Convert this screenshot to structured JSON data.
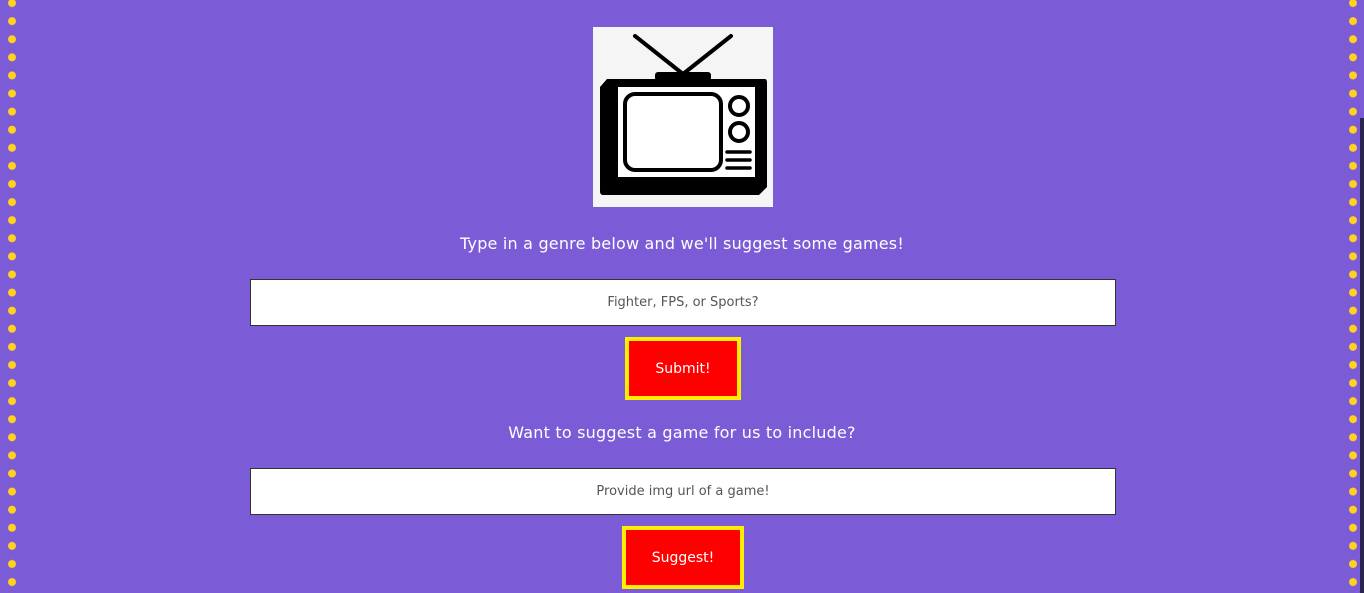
{
  "colors": {
    "background": "#7b5cd6",
    "dot_border": "#ffd21f",
    "button_fill": "#ff0000",
    "button_border": "#ffee00",
    "text": "#ffffff"
  },
  "logo": {
    "icon": "television-icon"
  },
  "genre_search": {
    "prompt": "Type in a genre below and we'll suggest some games!",
    "placeholder": "Fighter, FPS, or Sports?",
    "value": "",
    "submit_label": "Submit!"
  },
  "game_suggestion": {
    "prompt": "Want to suggest a game for us to include?",
    "placeholder": "Provide img url of a game!",
    "value": "",
    "submit_label": "Suggest!"
  }
}
